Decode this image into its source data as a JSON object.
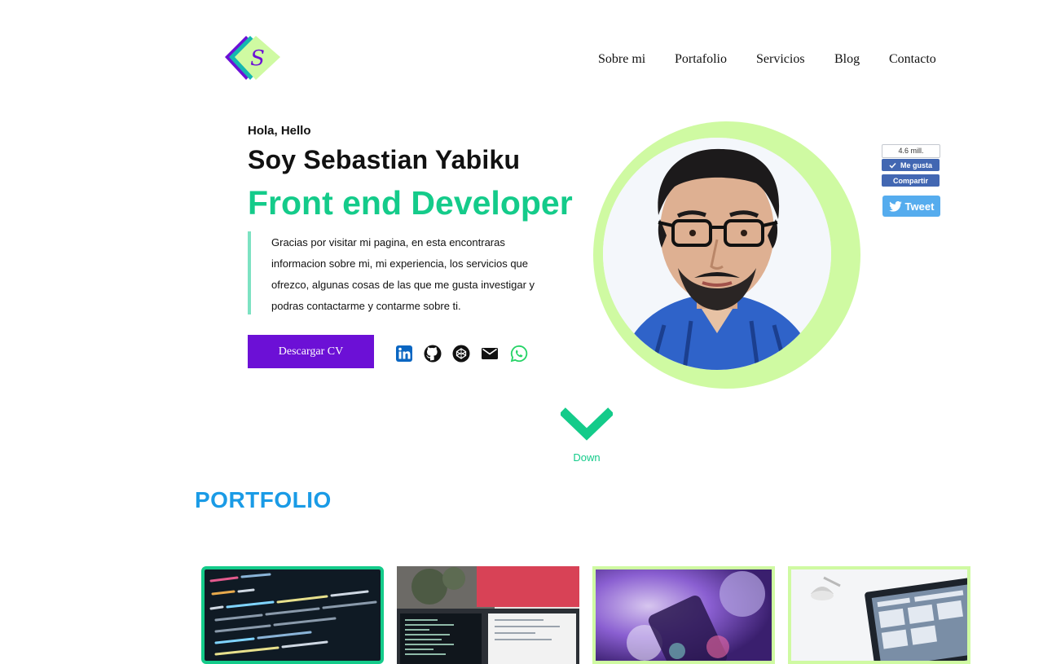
{
  "logo": {
    "icon": "signature-s-logo",
    "letter": "S"
  },
  "nav": {
    "items": [
      {
        "label": "Sobre mi"
      },
      {
        "label": "Portafolio"
      },
      {
        "label": "Servicios"
      },
      {
        "label": "Blog"
      },
      {
        "label": "Contacto"
      }
    ]
  },
  "hero": {
    "greeting": "Hola, Hello",
    "name": "Soy Sebastian Yabiku",
    "role": "Front end Developer",
    "bio_lines": [
      "Gracias por visitar mi pagina, en esta encontraras",
      "informacion sobre mi, mi experiencia, los servicios que",
      "ofrezco, algunas cosas de las que me gusta investigar y",
      "podras contactarme y contarme sobre ti."
    ],
    "cv_button": "Descargar CV",
    "social": [
      {
        "icon": "linkedin-icon",
        "color": "#0a66c2"
      },
      {
        "icon": "github-icon",
        "color": "#111111"
      },
      {
        "icon": "codepen-icon",
        "color": "#111111"
      },
      {
        "icon": "email-icon",
        "color": "#111111"
      },
      {
        "icon": "whatsapp-icon",
        "color": "#25d366"
      }
    ]
  },
  "share": {
    "like_count": "4.6 mill.",
    "like_label": "Me gusta",
    "share_label": "Compartir",
    "tweet_label": "Tweet"
  },
  "scroll": {
    "label": "Down"
  },
  "portfolio": {
    "title": "PORTFOLIO"
  },
  "colors": {
    "accent_green": "#14cb8a",
    "accent_purple": "#6c10d6",
    "ring_lime": "#cffaa2",
    "portfolio_blue": "#1a9be6"
  }
}
